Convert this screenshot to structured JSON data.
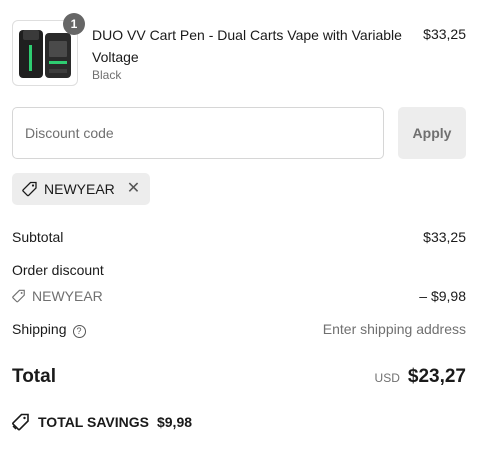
{
  "product": {
    "image_icon": "vape-device-image",
    "quantity": "1",
    "name": "DUO VV Cart Pen - Dual Carts Vape with Variable Voltage",
    "variant": "Black",
    "price": "$33,25"
  },
  "discount": {
    "placeholder": "Discount code",
    "value": "",
    "apply_label": "Apply",
    "applied_code": "NEWYEAR"
  },
  "summary": {
    "subtotal_label": "Subtotal",
    "subtotal_value": "$33,25",
    "order_discount_label": "Order discount",
    "discount_code": "NEWYEAR",
    "discount_value": "– $9,98",
    "shipping_label": "Shipping",
    "shipping_help_glyph": "?",
    "shipping_value": "Enter shipping address",
    "total_label": "Total",
    "currency": "USD",
    "total_value": "$23,27",
    "savings_label": "TOTAL SAVINGS",
    "savings_value": "$9,98"
  },
  "colors": {
    "text": "#1a1a1a",
    "muted": "#707070",
    "chip_bg": "#ededed",
    "border": "#d6d6d6",
    "badge": "#666666"
  }
}
